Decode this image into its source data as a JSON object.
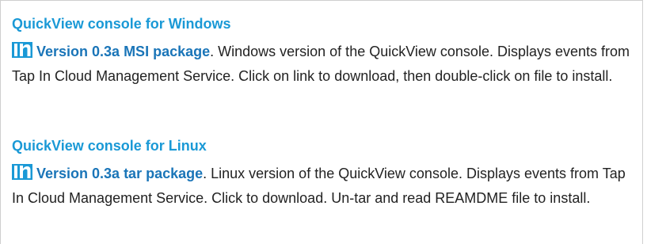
{
  "sections": [
    {
      "heading": "QuickView console for Windows",
      "icon": "linkedin-in-icon",
      "link_text": "Version 0.3a MSI package",
      "description": ". Windows version of the QuickView console. Displays events from Tap In Cloud Management Service. Click on link to download, then double-click on file to install."
    },
    {
      "heading": "QuickView console for Linux",
      "icon": "linkedin-in-icon",
      "link_text": "Version 0.3a tar package",
      "description": ". Linux version of the QuickView console. Displays events from Tap In Cloud Management Service. Click to download. Un-tar and read REAMDME file to install."
    }
  ],
  "colors": {
    "heading": "#1a99d6",
    "link": "#1a75b8",
    "icon": "#1a99d6",
    "text": "#222222"
  }
}
